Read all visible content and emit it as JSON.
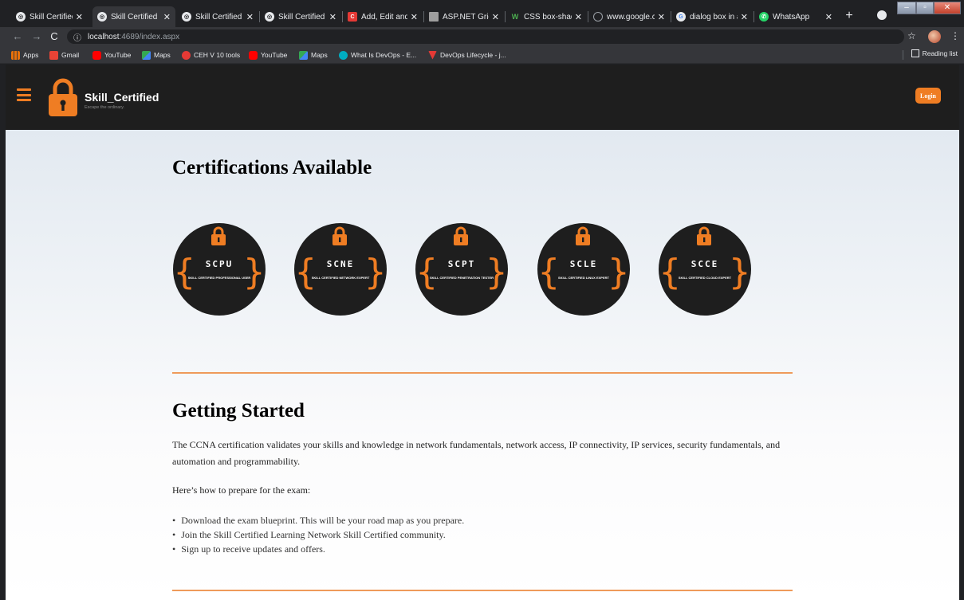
{
  "browser": {
    "tabs": [
      {
        "title": "Skill Certified",
        "active": false,
        "favicon": "globe-icon",
        "color": "#e8eaed"
      },
      {
        "title": "Skill Certified",
        "active": true,
        "favicon": "globe-icon",
        "color": "#e8eaed"
      },
      {
        "title": "Skill Certified",
        "active": false,
        "favicon": "globe-icon",
        "color": "#e8eaed"
      },
      {
        "title": "Skill Certified",
        "active": false,
        "favicon": "globe-icon",
        "color": "#e8eaed"
      },
      {
        "title": "Add, Edit and D",
        "active": false,
        "favicon": "c-icon",
        "color": "#e53935"
      },
      {
        "title": "ASP.NET GridV",
        "active": false,
        "favicon": "grid-icon",
        "color": "#9e9e9e"
      },
      {
        "title": "CSS box-shado",
        "active": false,
        "favicon": "w3-icon",
        "color": "#2e7d32"
      },
      {
        "title": "www.google.co",
        "active": false,
        "favicon": "globe-icon",
        "color": "#9aa0a6"
      },
      {
        "title": "dialog box in a",
        "active": false,
        "favicon": "google-icon",
        "color": "#e8eaed"
      },
      {
        "title": "WhatsApp",
        "active": false,
        "favicon": "whatsapp-icon",
        "color": "#25d366"
      }
    ],
    "url_host": "localhost",
    "url_path": ":4689/index.aspx",
    "bookmarks": [
      {
        "label": "Apps",
        "icon": "apps-grid-icon",
        "color": "#e8710a"
      },
      {
        "label": "Gmail",
        "icon": "gmail-icon",
        "color": "#ea4335"
      },
      {
        "label": "YouTube",
        "icon": "youtube-icon",
        "color": "#ff0000"
      },
      {
        "label": "Maps",
        "icon": "maps-icon",
        "color": "#34a853"
      },
      {
        "label": "CEH V 10 tools",
        "icon": "ceh-icon",
        "color": "#e53935"
      },
      {
        "label": "YouTube",
        "icon": "youtube-icon",
        "color": "#ff0000"
      },
      {
        "label": "Maps",
        "icon": "maps-icon",
        "color": "#34a853"
      },
      {
        "label": "What Is DevOps - E...",
        "icon": "devops-icon",
        "color": "#00acc1"
      },
      {
        "label": "DevOps Lifecycle - j...",
        "icon": "devops-lifecycle-icon",
        "color": "#e53935"
      }
    ],
    "reading_list": "Reading list"
  },
  "site": {
    "brand": "Skill_Certified",
    "tagline": "Escape the ordinary.",
    "login_label": "Login",
    "accent": "#ef7d23"
  },
  "certifications": {
    "title": "Certifications Available",
    "items": [
      {
        "code": "SCPU",
        "name": "SKILL CERTIFIED PROFESSIONAL USER"
      },
      {
        "code": "SCNE",
        "name": "SKILL CERTIFIED NETWORK EXPERT"
      },
      {
        "code": "SCPT",
        "name": "SKILL CERTIFIED PENETRATION TESTER"
      },
      {
        "code": "SCLE",
        "name": "SKILL CERTIFIED LINUX EXPERT"
      },
      {
        "code": "SCCE",
        "name": "SKILL CERTIFIED CLOUD EXPERT"
      }
    ]
  },
  "getting_started": {
    "title": "Getting Started",
    "intro": "The CCNA certification validates your skills and knowledge in network fundamentals, network access, IP connectivity, IP services, security fundamentals, and automation and programmability.",
    "prep": "Here’s how to prepare for the exam:",
    "steps": [
      "Download the exam blueprint. This will be your road map as you prepare.",
      "Join the Skill Certified Learning Network Skill Certified community.",
      "Sign up to receive updates and offers."
    ]
  }
}
